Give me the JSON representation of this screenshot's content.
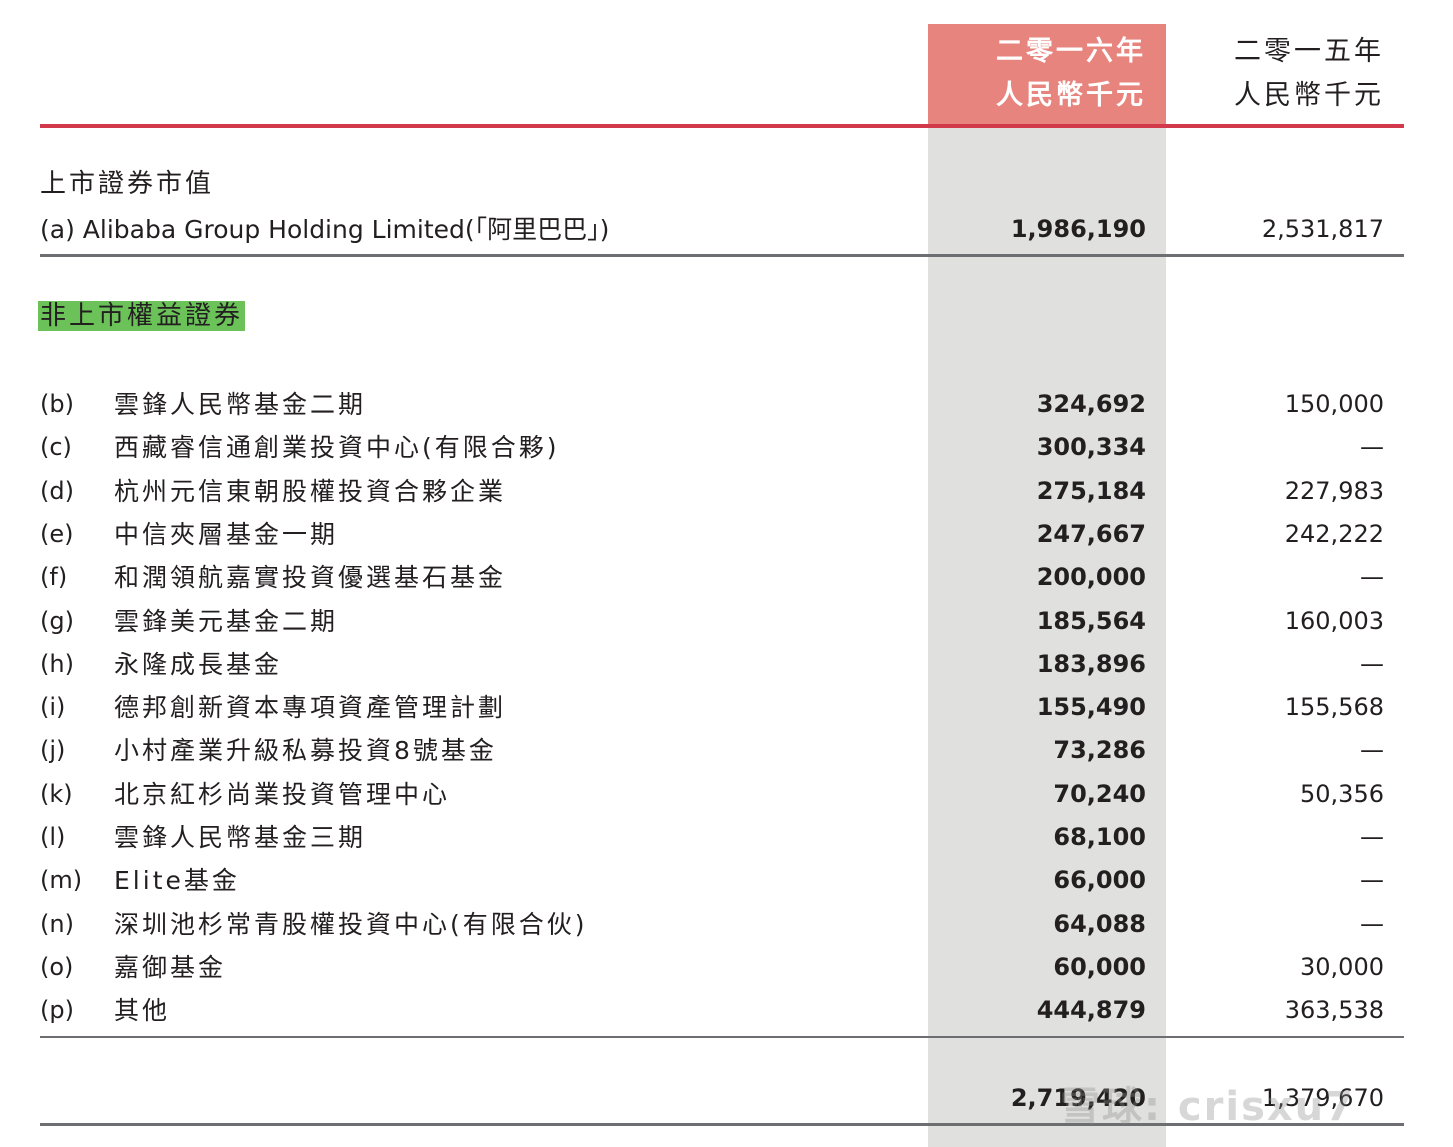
{
  "header": {
    "col2016_line1": "二零一六年",
    "col2016_line2": "人民幣千元",
    "col2015_line1": "二零一五年",
    "col2015_line2": "人民幣千元"
  },
  "listed": {
    "title": "上市證券市值",
    "row": {
      "name": "(a) Alibaba Group Holding Limited(「阿里巴巴」)",
      "v2016": "1,986,190",
      "v2015": "2,531,817"
    }
  },
  "unlisted": {
    "title": "非上市權益證券",
    "rows": [
      {
        "code": "(b)",
        "name": "雲鋒人民幣基金二期",
        "v2016": "324,692",
        "v2015": "150,000"
      },
      {
        "code": "(c)",
        "name": "西藏睿信通創業投資中心(有限合夥)",
        "v2016": "300,334",
        "v2015": "—"
      },
      {
        "code": "(d)",
        "name": "杭州元信東朝股權投資合夥企業",
        "v2016": "275,184",
        "v2015": "227,983"
      },
      {
        "code": "(e)",
        "name": "中信夾層基金一期",
        "v2016": "247,667",
        "v2015": "242,222"
      },
      {
        "code": "(f)",
        "name": "和潤領航嘉實投資優選基石基金",
        "v2016": "200,000",
        "v2015": "—"
      },
      {
        "code": "(g)",
        "name": "雲鋒美元基金二期",
        "v2016": "185,564",
        "v2015": "160,003"
      },
      {
        "code": "(h)",
        "name": "永隆成長基金",
        "v2016": "183,896",
        "v2015": "—"
      },
      {
        "code": "(i)",
        "name": "德邦創新資本專項資產管理計劃",
        "v2016": "155,490",
        "v2015": "155,568"
      },
      {
        "code": "(j)",
        "name": "小村產業升級私募投資8號基金",
        "v2016": "73,286",
        "v2015": "—"
      },
      {
        "code": "(k)",
        "name": "北京紅杉尚業投資管理中心",
        "v2016": "70,240",
        "v2015": "50,356"
      },
      {
        "code": "(l)",
        "name": "雲鋒人民幣基金三期",
        "v2016": "68,100",
        "v2015": "—"
      },
      {
        "code": "(m)",
        "name": "Elite基金",
        "v2016": "66,000",
        "v2015": "—"
      },
      {
        "code": "(n)",
        "name": "深圳池杉常青股權投資中心(有限合伙)",
        "v2016": "64,088",
        "v2015": "—"
      },
      {
        "code": "(o)",
        "name": "嘉御基金",
        "v2016": "60,000",
        "v2015": "30,000"
      },
      {
        "code": "(p)",
        "name": "其他",
        "v2016": "444,879",
        "v2015": "363,538"
      }
    ],
    "total": {
      "v2016": "2,719,420",
      "v2015": "1,379,670"
    }
  },
  "watermark": "雪球: crisxu7"
}
